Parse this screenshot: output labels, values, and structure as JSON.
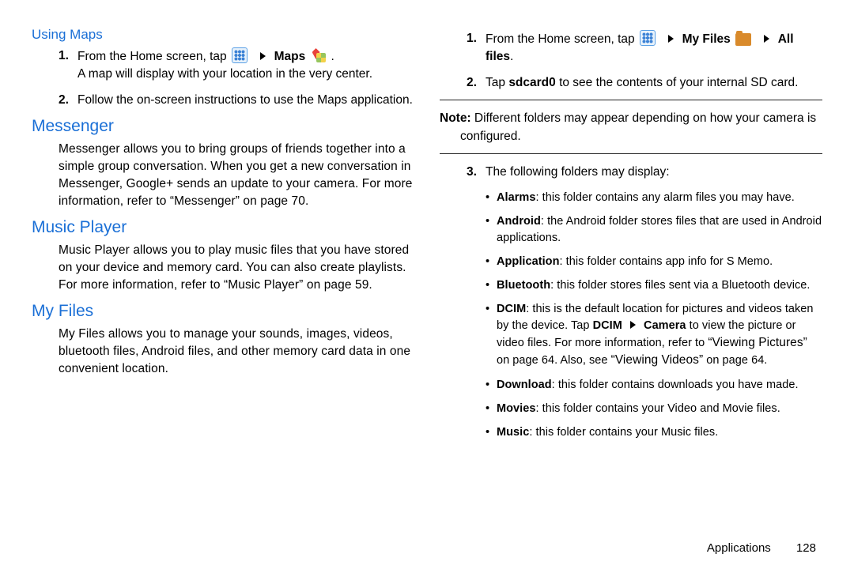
{
  "left": {
    "using_maps": {
      "heading": "Using Maps",
      "step1_prefix": "From the Home screen, tap ",
      "step1_maps_label": "Maps",
      "step1_tail": ".",
      "step1_line2": "A map will display with your location in the very center.",
      "step2": "Follow the on-screen instructions to use the Maps application."
    },
    "messenger": {
      "heading": "Messenger",
      "para_a": "Messenger allows you to bring groups of friends together into a simple group conversation. When you get a new conversation in Messenger, Google+ sends an update to your camera. For more information, refer to ",
      "ref": "“Messenger” ",
      "para_b": "on page 70."
    },
    "music": {
      "heading": "Music Player",
      "para_a": "Music Player allows you to play music files that you have stored on your device and memory card. You can also create playlists. For more information, refer to ",
      "ref": "“Music Player” ",
      "para_b": "on page 59."
    },
    "myfiles": {
      "heading": "My Files",
      "para": "My Files allows you to manage your sounds, images, videos, bluetooth files, Android files, and other memory card data in one convenient location."
    }
  },
  "right": {
    "step1_prefix": "From the Home screen, tap ",
    "step1_myfiles": "My Files",
    "step1_allfiles": "All files",
    "step1_period": ".",
    "step2_a": "Tap ",
    "step2_b": "sdcard0",
    "step2_c": " to see the contents of your internal SD card.",
    "note_label": "Note: ",
    "note_text": "Different folders may appear depending on how your camera is configured.",
    "step3": "The following folders may display:",
    "bullets": {
      "alarms_b": "Alarms",
      "alarms_t": ": this folder contains any alarm files you may have.",
      "android_b": "Android",
      "android_t": ": the Android folder stores files that are used in Android applications.",
      "application_b": "Application",
      "application_t": ": this folder contains app info for S Memo.",
      "bluetooth_b": "Bluetooth",
      "bluetooth_t": ": this folder stores files sent via a Bluetooth device.",
      "dcim_b": "DCIM",
      "dcim_t1": ": this is the default location for pictures and videos taken by the device. Tap ",
      "dcim_b2": "DCIM",
      "dcim_arrow_then": "Camera",
      "dcim_t2": " to view the picture or video files. For more information, refer to ",
      "dcim_ref1": "“Viewing Pictures”",
      "dcim_t3": " on page 64. Also, see ",
      "dcim_ref2": "“Viewing Videos”",
      "dcim_t4": " on page 64.",
      "download_b": "Download",
      "download_t": ": this folder contains downloads you have made.",
      "movies_b": "Movies",
      "movies_t": ": this folder contains your Video and Movie files.",
      "music_b": "Music",
      "music_t": ": this folder contains your Music files."
    }
  },
  "footer": {
    "label": "Applications",
    "page": "128"
  }
}
